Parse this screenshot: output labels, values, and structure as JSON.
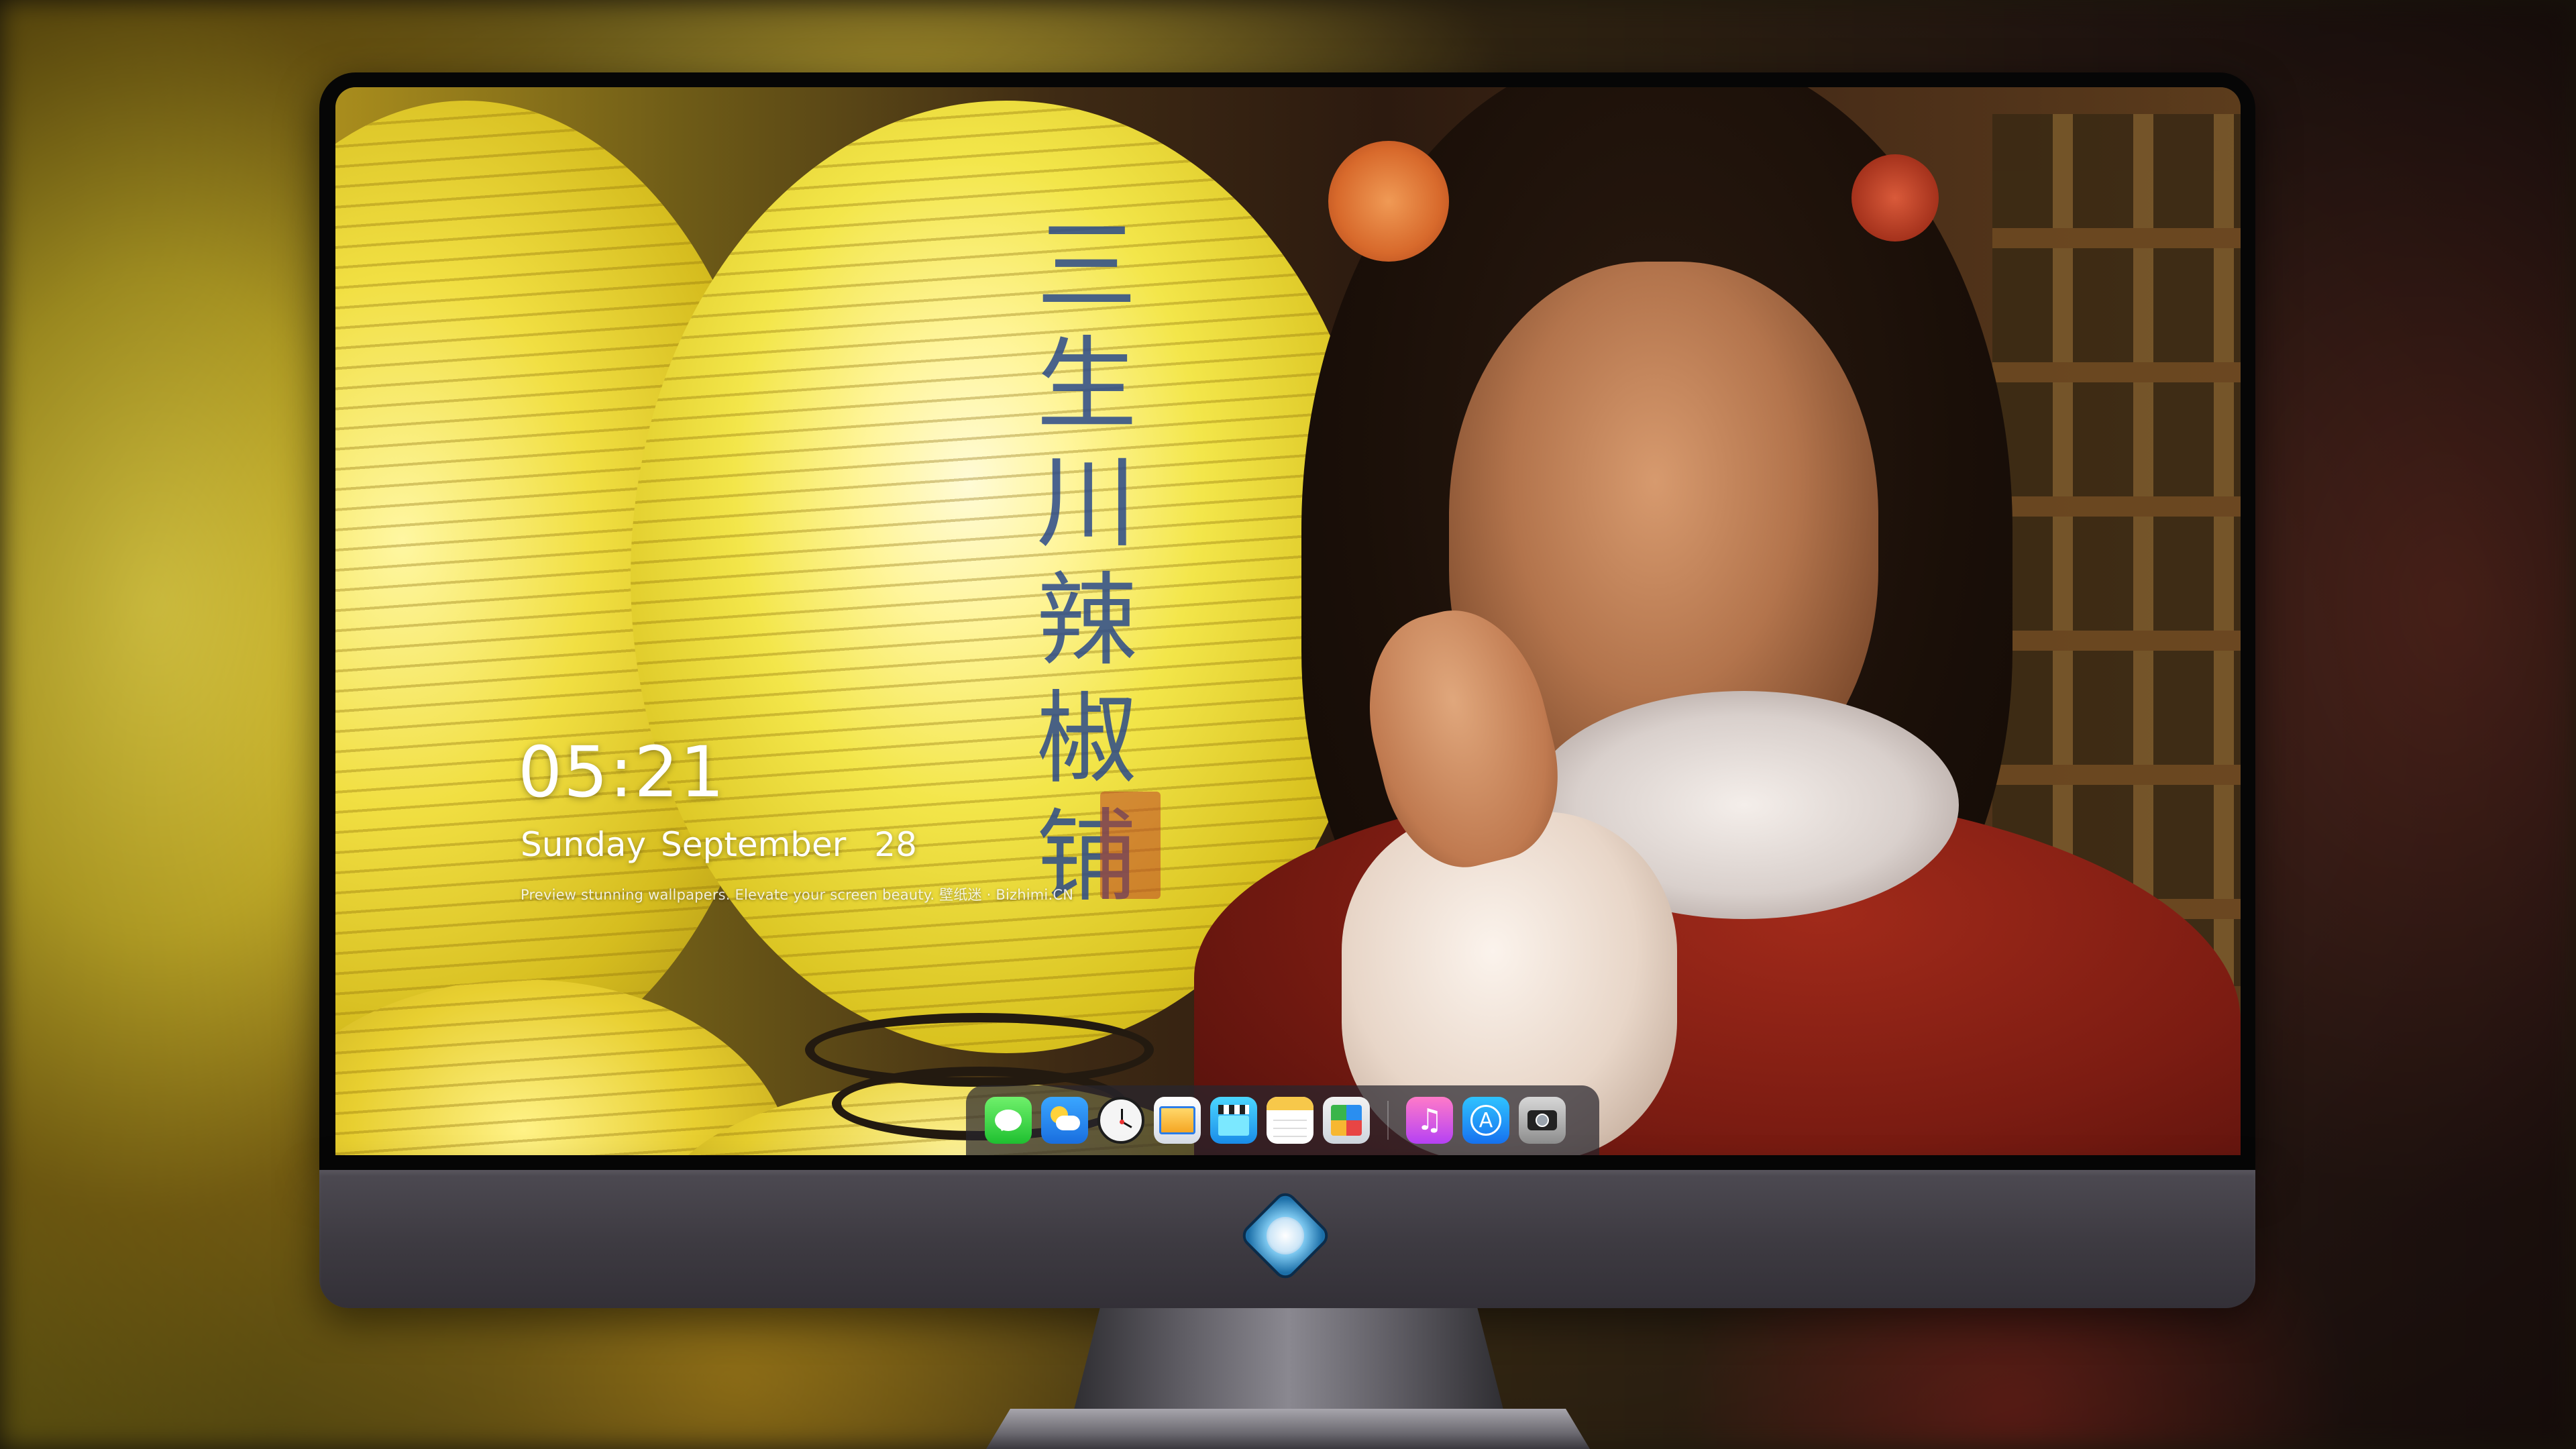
{
  "lock_screen": {
    "time": "05:21",
    "weekday": "Sunday",
    "month": "September",
    "day": "28",
    "tagline": "Preview stunning wallpapers. Elevate your screen beauty.  壁纸迷 · Bizhimi.CN"
  },
  "wallpaper": {
    "lantern_text": "三生川辣椒铺",
    "lantern_chars": [
      "三",
      "生",
      "川",
      "辣",
      "椒",
      "铺"
    ]
  },
  "dock": {
    "items": [
      {
        "name": "messages",
        "icon": "messages-icon",
        "color": "#20c131"
      },
      {
        "name": "weather",
        "icon": "weather-icon",
        "color": "#1a6fe0"
      },
      {
        "name": "clock",
        "icon": "clock-icon",
        "color": "#f5f5f5"
      },
      {
        "name": "preview",
        "icon": "preview-icon",
        "color": "#2b7de9"
      },
      {
        "name": "clips",
        "icon": "clips-icon",
        "color": "#1a8de9"
      },
      {
        "name": "notes",
        "icon": "notes-icon",
        "color": "#f7c84a"
      },
      {
        "name": "photos",
        "icon": "photos-icon",
        "color": "#39b54a"
      },
      {
        "name": "music",
        "icon": "music-icon",
        "color": "#b642f5",
        "glyph": "♫"
      },
      {
        "name": "app-store",
        "icon": "app-store-icon",
        "color": "#1772f0",
        "glyph": "A"
      },
      {
        "name": "camera",
        "icon": "camera-icon",
        "color": "#8e8e8e"
      }
    ]
  },
  "device": {
    "chin_logo": "bizhimi-logo-icon"
  }
}
